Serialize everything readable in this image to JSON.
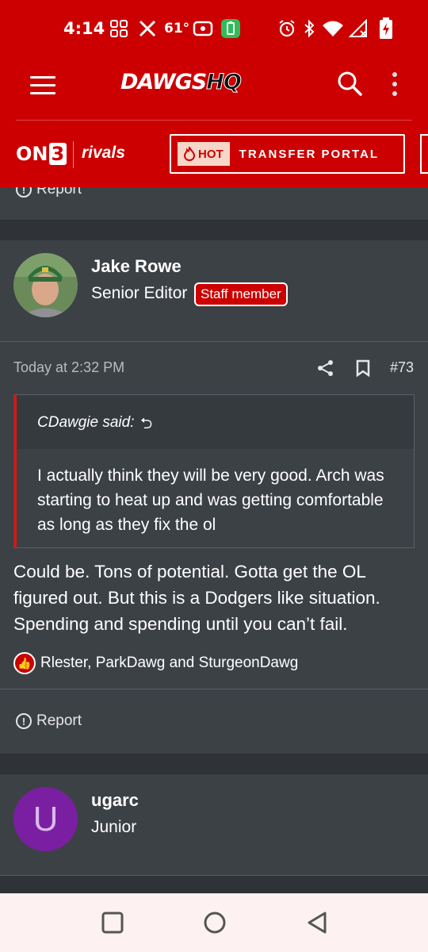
{
  "status_bar": {
    "time": "4:14",
    "temperature": "61°",
    "icons": [
      "grid-icon",
      "x-icon",
      "radio-icon",
      "battery-saver-icon",
      "alarm-icon",
      "bluetooth-icon",
      "wifi-icon",
      "signal-icon",
      "battery-charging-icon"
    ]
  },
  "header": {
    "logo_main": "DAWGS",
    "logo_hq": "HQ"
  },
  "brand_bar": {
    "on3_on": "ON",
    "on3_three": "3",
    "rivals": "rivals",
    "hot_label": "HOT",
    "portal_label": "TRANSFER PORTAL"
  },
  "previous_post": {
    "report_label": "Report"
  },
  "post": {
    "username": "Jake Rowe",
    "user_title": "Senior Editor",
    "staff_badge": "Staff member",
    "time": "Today at 2:32 PM",
    "post_number": "#73",
    "quote": {
      "author": "CDawgie said:",
      "text": "I actually think they will be very good. Arch was starting to heat up and was getting comfortable as long as they fix the ol"
    },
    "text": "Could be. Tons of potential. Gotta get the OL figured out. But this is a Dodgers like situation. Spending and spending until you can’t fail.",
    "reactions": "Rlester, ParkDawg and SturgeonDawg",
    "report_label": "Report"
  },
  "next_post": {
    "avatar_letter": "U",
    "username": "ugarc",
    "user_title": "Junior"
  },
  "colors": {
    "brand_red": "#cc0000",
    "post_bg": "#3c4146",
    "page_bg": "#2f3337",
    "avatar_purple": "#7a1fa2"
  }
}
